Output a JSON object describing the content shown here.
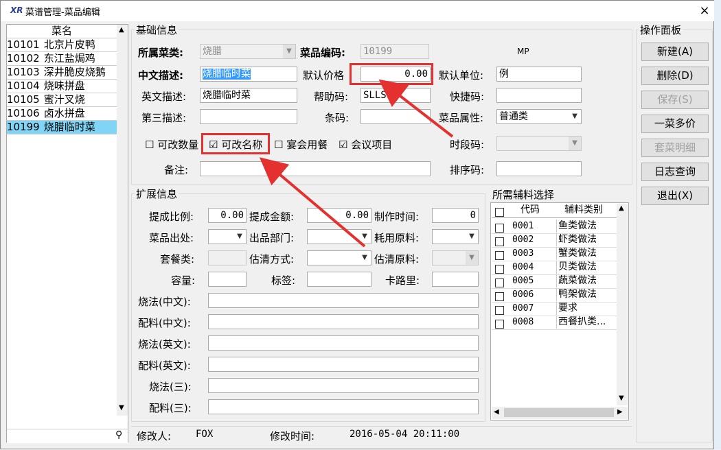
{
  "window": {
    "title": "菜谱管理-菜品编辑",
    "logo": "XR",
    "close": "×"
  },
  "left_list": {
    "header": "菜名",
    "items": [
      {
        "code": "10101",
        "name": "北京片皮鸭"
      },
      {
        "code": "10102",
        "name": "东江盐焗鸡"
      },
      {
        "code": "10103",
        "name": "深井脆皮烧鹅"
      },
      {
        "code": "10104",
        "name": "烧味拼盘"
      },
      {
        "code": "10105",
        "name": "蜜汁叉烧"
      },
      {
        "code": "10106",
        "name": "卤水拼盘"
      },
      {
        "code": "10199",
        "name": "烧腊临时菜"
      }
    ],
    "search_icon": "⚲"
  },
  "basic": {
    "group_label": "基础信息",
    "category_label": "所属菜类:",
    "category_value": "烧腊",
    "code_label": "菜品编码:",
    "code_value": "10199",
    "mp": "MP",
    "cn_desc_label": "中文描述:",
    "cn_desc_value": "烧腊临时菜",
    "price_label": "默认价格",
    "price_value": "0.00",
    "unit_label": "默认单位:",
    "unit_value": "例",
    "en_desc_label": "英文描述:",
    "en_desc_value": "烧腊临时菜",
    "help_label": "帮助码:",
    "help_value": "SLLSC",
    "shortcut_label": "快捷码:",
    "third_label": "第三描述:",
    "barcode_label": "条码:",
    "attr_label": "菜品属性:",
    "attr_value": "普通类",
    "chk_qty": "可改数量",
    "chk_name": "可改名称",
    "chk_banquet": "宴会用餐",
    "chk_meeting": "会议项目",
    "period_label": "时段码:",
    "note_label": "备注:",
    "sort_label": "排序码:"
  },
  "ext": {
    "group_label": "扩展信息",
    "commission_ratio_label": "提成比例:",
    "commission_ratio_value": "0.00",
    "commission_amount_label": "提成金额:",
    "commission_amount_value": "0.00",
    "make_time_label": "制作时间:",
    "make_time_value": "0",
    "origin_label": "菜品出处:",
    "dept_label": "出品部门:",
    "material_label": "耗用原料:",
    "set_label": "套餐类:",
    "estimate_label": "估清方式:",
    "estimate_mat_label": "估清原料:",
    "capacity_label": "容量:",
    "tag_label": "标签:",
    "calorie_label": "卡路里:",
    "cook_cn_label": "烧法(中文):",
    "ing_cn_label": "配料(中文):",
    "cook_en_label": "烧法(英文):",
    "ing_en_label": "配料(英文):",
    "cook_3_label": "烧法(三):",
    "ing_3_label": "配料(三):"
  },
  "aux": {
    "group_label": "所需辅料选择",
    "col_code": "代码",
    "col_type": "辅料类别",
    "rows": [
      {
        "code": "0001",
        "type": "鱼类做法"
      },
      {
        "code": "0002",
        "type": "虾类做法"
      },
      {
        "code": "0003",
        "type": "蟹类做法"
      },
      {
        "code": "0004",
        "type": "贝类做法"
      },
      {
        "code": "0005",
        "type": "蔬菜做法"
      },
      {
        "code": "0006",
        "type": "鸭架做法"
      },
      {
        "code": "0007",
        "type": "要求"
      },
      {
        "code": "0008",
        "type": "西餐扒类..."
      }
    ]
  },
  "panel": {
    "group_label": "操作面板",
    "buttons": [
      "新建(A)",
      "删除(D)",
      "保存(S)",
      "一菜多价",
      "套菜明细",
      "日志查询",
      "退出(X)"
    ]
  },
  "footer": {
    "modifier_label": "修改人:",
    "modifier_value": "FOX",
    "modtime_label": "修改时间:",
    "modtime_value": "2016-05-04 20:11:00"
  },
  "colors": {
    "highlight_red": "#e53030",
    "selection_blue": "#3399ff",
    "list_active": "#80d4f5"
  }
}
